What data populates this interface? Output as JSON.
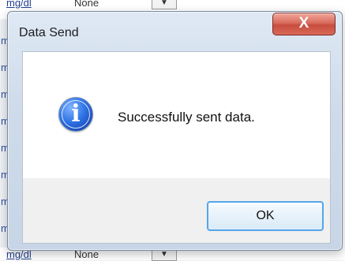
{
  "background": {
    "top_row": {
      "unit": "mg/dl",
      "selection": "None"
    },
    "bottom_row": {
      "unit": "mg/dl",
      "selection": "None"
    },
    "edge_letters": [
      "m",
      "m",
      "m",
      "m",
      "m",
      "m",
      "m",
      "m"
    ]
  },
  "dialog": {
    "title": "Data Send",
    "close_label": "X",
    "message": "Successfully sent data.",
    "ok_label": "OK",
    "icon": "info-icon"
  },
  "colors": {
    "close_button": "#cf5a4b",
    "ok_border": "#55a6e8",
    "window_frame": "#cfdbea"
  }
}
